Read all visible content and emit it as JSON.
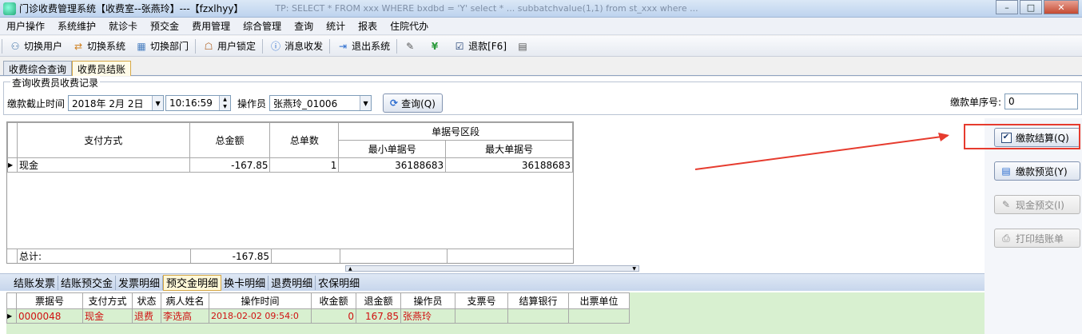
{
  "window": {
    "title": "门诊收费管理系统【收费室--张燕玲】---【fzxlhyy】",
    "ghost_text": "TP: SELECT * FROM xxx WHERE bxdbd = 'Y' select * ... subbatchvalue(1,1) from st_xxx where ...",
    "min_glyph": "–",
    "max_glyph": "□",
    "close_glyph": "✕"
  },
  "menu": [
    "用户操作",
    "系统维护",
    "就诊卡",
    "预交金",
    "费用管理",
    "综合管理",
    "查询",
    "统计",
    "报表",
    "住院代办"
  ],
  "toolbar": {
    "items": [
      {
        "label": "切换用户",
        "icon": "⚇"
      },
      {
        "label": "切换系统",
        "icon": "⇄"
      },
      {
        "label": "切换部门",
        "icon": "▦"
      },
      {
        "label": "用户锁定",
        "icon": "☖"
      },
      {
        "label": "消息收发",
        "icon": "ⓘ"
      },
      {
        "label": "退出系统",
        "icon": "⇥"
      },
      {
        "label": "",
        "icon": "✎"
      },
      {
        "label": "",
        "icon": "¥"
      },
      {
        "label": "退款[F6]",
        "icon": "☑"
      },
      {
        "label": "",
        "icon": "▤"
      }
    ]
  },
  "top_tabs": [
    {
      "label": "收费综合查询",
      "active": false
    },
    {
      "label": "收费员结账",
      "active": true
    }
  ],
  "query": {
    "group_title": "查询收费员收费记录",
    "deadline_label": "缴款截止时间",
    "date_value": "2018年  2月  2日",
    "time_value": "10:16:59",
    "operator_label": "操作员",
    "operator_value": "张燕玲_01006",
    "query_button": "查询(Q)",
    "serial_label": "缴款单序号:",
    "serial_value": "0"
  },
  "summary_table": {
    "headers": {
      "pay_method": "支付方式",
      "total_amount": "总金额",
      "total_count": "总单数",
      "range_group": "单据号区段",
      "min_no": "最小单据号",
      "max_no": "最大单据号"
    },
    "rows": [
      {
        "pay_method": "现金",
        "total_amount": "-167.85",
        "total_count": "1",
        "min_no": "36188683",
        "max_no": "36188683"
      }
    ],
    "total_label": "总计:",
    "total_amount": "-167.85"
  },
  "side_buttons": [
    {
      "label": "缴款结算(Q)",
      "enabled": true,
      "icon": "✔"
    },
    {
      "label": "缴款预览(Y)",
      "enabled": true,
      "icon": "▤"
    },
    {
      "label": "现金预交(I)",
      "enabled": false,
      "icon": "✎"
    },
    {
      "label": "打印结账单",
      "enabled": false,
      "icon": "⎙"
    }
  ],
  "bottom_tabs": [
    {
      "label": "结账发票",
      "active": false
    },
    {
      "label": "结账预交金",
      "active": false
    },
    {
      "label": "发票明细",
      "active": false
    },
    {
      "label": "预交金明细",
      "active": true
    },
    {
      "label": "换卡明细",
      "active": false
    },
    {
      "label": "退费明细",
      "active": false
    },
    {
      "label": "农保明细",
      "active": false
    }
  ],
  "detail_table": {
    "headers": [
      "票据号",
      "支付方式",
      "状态",
      "病人姓名",
      "操作时间",
      "收金额",
      "退金额",
      "操作员",
      "支票号",
      "结算银行",
      "出票单位"
    ],
    "rows": [
      [
        "0000048",
        "现金",
        "退费",
        "李选高",
        "2018-02-02 09:54:0",
        "0",
        "167.85",
        "张燕玲",
        "",
        "",
        ""
      ]
    ]
  },
  "colors": {
    "annotation_red": "#e63b2e",
    "detail_row_bg": "#d8f0d0",
    "detail_text_red": "#d01010"
  }
}
